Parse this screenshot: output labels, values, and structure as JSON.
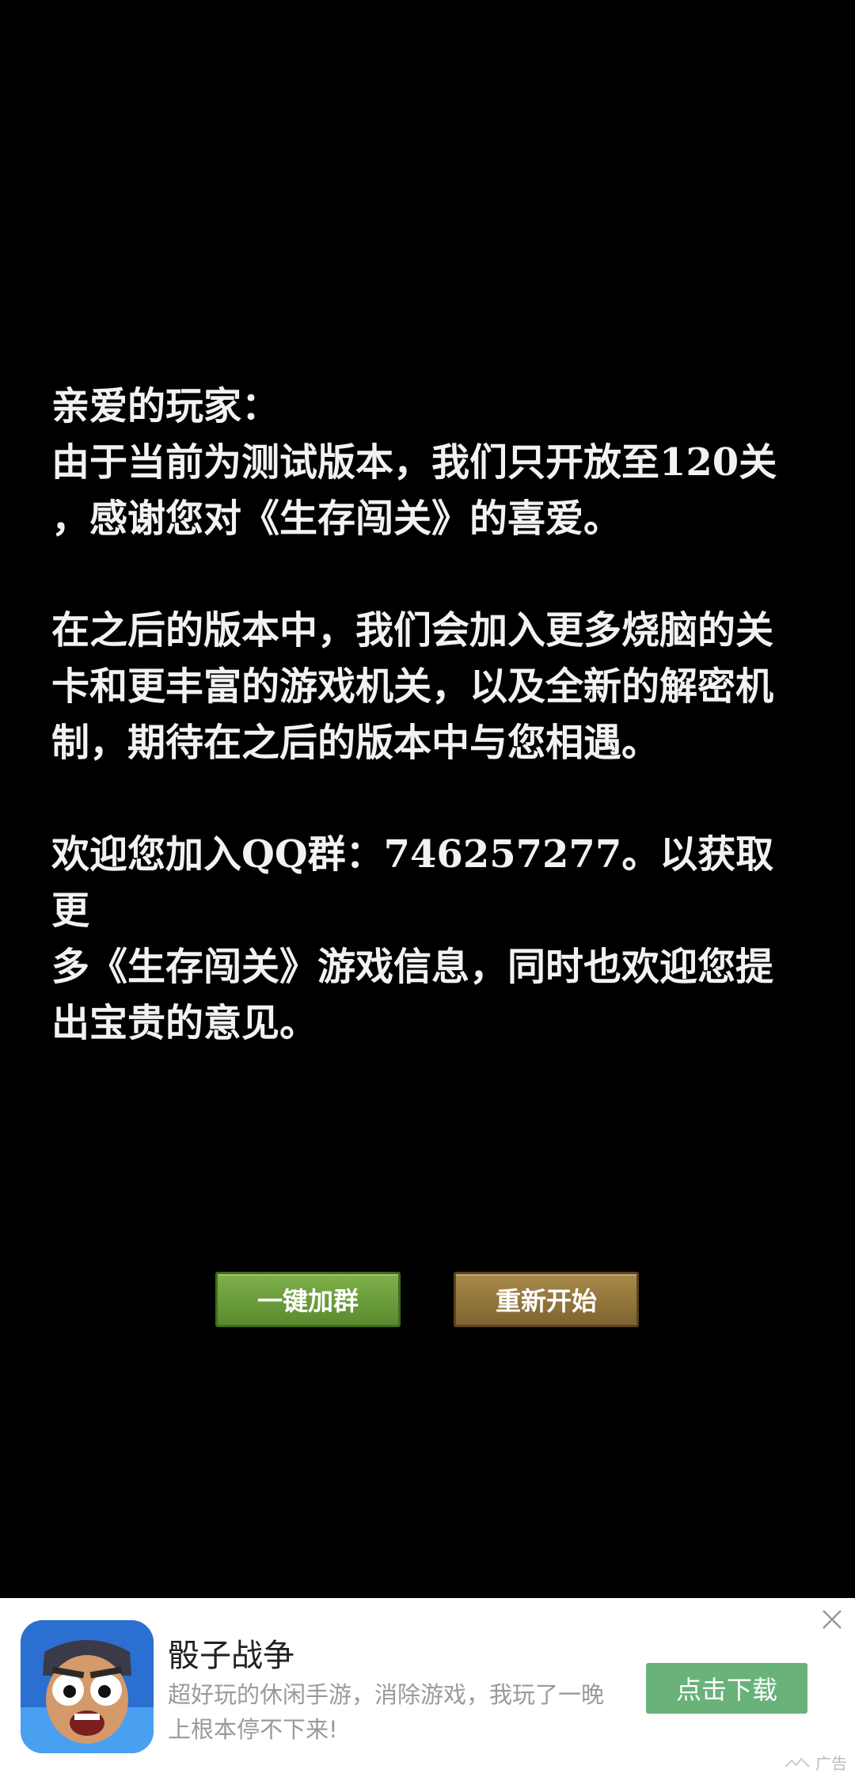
{
  "message": {
    "greeting": "亲爱的玩家：",
    "para1_line1": "由于当前为测试版本，我们只开放至120关",
    "para1_line2": "，感谢您对《生存闯关》的喜爱。",
    "para2_line1": "在之后的版本中，我们会加入更多烧脑的关",
    "para2_line2": "卡和更丰富的游戏机关，以及全新的解密机",
    "para2_line3": "制，期待在之后的版本中与您相遇。",
    "para3_line1": "欢迎您加入QQ群：746257277。以获取更",
    "para3_line2": "多《生存闯关》游戏信息，同时也欢迎您提",
    "para3_line3": "出宝贵的意见。"
  },
  "buttons": {
    "join_group": "一键加群",
    "restart": "重新开始"
  },
  "ad": {
    "app_icon": "dice-war-app-icon",
    "title": "骰子战争",
    "desc_line1": "超好玩的休闲手游，消除游戏，我玩了一晚",
    "desc_line2": "上根本停不下来!",
    "download_label": "点击下载",
    "close_icon": "close-icon",
    "ad_label": "广告",
    "colors": {
      "join_button": "#6a9c3a",
      "restart_button": "#967840",
      "download_button": "#69b27a"
    }
  }
}
